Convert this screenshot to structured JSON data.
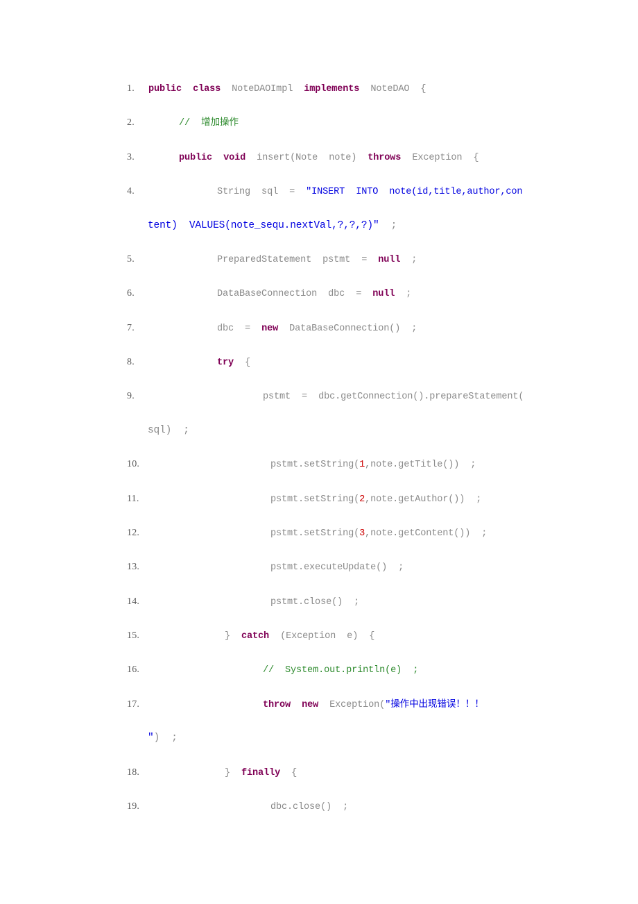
{
  "document": {
    "kind": "code-listing",
    "language": "Java",
    "background_color": "#ffffff",
    "colors": {
      "keyword": "#7F0055",
      "comment": "#2E8B2E",
      "string": "#0000E0",
      "number": "#CC0000",
      "identifier": "#8a8a8a",
      "line_number": "#5a5a5a"
    }
  },
  "lines": [
    {
      "number": "1.",
      "indent": 1,
      "tokens": [
        {
          "t": "public",
          "c": "kw"
        },
        {
          "t": "  ",
          "c": "pn"
        },
        {
          "t": "class",
          "c": "kw"
        },
        {
          "t": "  ",
          "c": "pn"
        },
        {
          "t": "NoteDAOImpl",
          "c": "id"
        },
        {
          "t": "  ",
          "c": "pn"
        },
        {
          "t": "implements",
          "c": "kw"
        },
        {
          "t": "  ",
          "c": "pn"
        },
        {
          "t": "NoteDAO",
          "c": "id"
        },
        {
          "t": "  {",
          "c": "pn"
        }
      ]
    },
    {
      "number": "2.",
      "indent": 5,
      "tokens": [
        {
          "t": "//  增加操作",
          "c": "cmt"
        }
      ]
    },
    {
      "number": "3.",
      "indent": 5,
      "tokens": [
        {
          "t": "public",
          "c": "kw"
        },
        {
          "t": "  ",
          "c": "pn"
        },
        {
          "t": "void",
          "c": "kw"
        },
        {
          "t": "  ",
          "c": "pn"
        },
        {
          "t": "insert(Note  note)",
          "c": "id"
        },
        {
          "t": "  ",
          "c": "pn"
        },
        {
          "t": "throws",
          "c": "kw"
        },
        {
          "t": "  ",
          "c": "pn"
        },
        {
          "t": "Exception",
          "c": "id"
        },
        {
          "t": "  {",
          "c": "pn"
        }
      ]
    },
    {
      "number": "4.",
      "indent": 10,
      "tokens": [
        {
          "t": "String  sql  =  ",
          "c": "id"
        },
        {
          "t": "\"INSERT  INTO  note(id,title,author,con",
          "c": "str"
        }
      ],
      "wrap": [
        {
          "t": "tent)  VALUES(note_sequ.nextVal,?,?,?)\"",
          "c": "str"
        },
        {
          "t": "  ;",
          "c": "pn"
        }
      ]
    },
    {
      "number": "5.",
      "indent": 10,
      "tokens": [
        {
          "t": "PreparedStatement  pstmt  =  ",
          "c": "id"
        },
        {
          "t": "null",
          "c": "kw"
        },
        {
          "t": "  ;",
          "c": "pn"
        }
      ]
    },
    {
      "number": "6.",
      "indent": 10,
      "tokens": [
        {
          "t": "DataBaseConnection  dbc  =  ",
          "c": "id"
        },
        {
          "t": "null",
          "c": "kw"
        },
        {
          "t": "  ;",
          "c": "pn"
        }
      ]
    },
    {
      "number": "7.",
      "indent": 10,
      "tokens": [
        {
          "t": "dbc  =  ",
          "c": "id"
        },
        {
          "t": "new",
          "c": "kw"
        },
        {
          "t": "  ",
          "c": "pn"
        },
        {
          "t": "DataBaseConnection()",
          "c": "id"
        },
        {
          "t": "  ;",
          "c": "pn"
        }
      ]
    },
    {
      "number": "8.",
      "indent": 10,
      "tokens": [
        {
          "t": "try",
          "c": "kw"
        },
        {
          "t": "  {",
          "c": "pn"
        }
      ]
    },
    {
      "number": "9.",
      "indent": 16,
      "tokens": [
        {
          "t": "pstmt  =  dbc.getConnection().prepareStatement(",
          "c": "id"
        }
      ],
      "wrap": [
        {
          "t": "sql)  ;",
          "c": "id"
        }
      ]
    },
    {
      "number": "10.",
      "indent": 17,
      "tokens": [
        {
          "t": "pstmt.setString(",
          "c": "id"
        },
        {
          "t": "1",
          "c": "num"
        },
        {
          "t": ",note.getTitle())",
          "c": "id"
        },
        {
          "t": "  ;",
          "c": "pn"
        }
      ]
    },
    {
      "number": "11.",
      "indent": 17,
      "tokens": [
        {
          "t": "pstmt.setString(",
          "c": "id"
        },
        {
          "t": "2",
          "c": "num"
        },
        {
          "t": ",note.getAuthor())",
          "c": "id"
        },
        {
          "t": "  ;",
          "c": "pn"
        }
      ]
    },
    {
      "number": "12.",
      "indent": 17,
      "tokens": [
        {
          "t": "pstmt.setString(",
          "c": "id"
        },
        {
          "t": "3",
          "c": "num"
        },
        {
          "t": ",note.getContent())",
          "c": "id"
        },
        {
          "t": "  ;",
          "c": "pn"
        }
      ]
    },
    {
      "number": "13.",
      "indent": 17,
      "tokens": [
        {
          "t": "pstmt.executeUpdate()",
          "c": "id"
        },
        {
          "t": "  ;",
          "c": "pn"
        }
      ]
    },
    {
      "number": "14.",
      "indent": 17,
      "tokens": [
        {
          "t": "pstmt.close()",
          "c": "id"
        },
        {
          "t": "  ;",
          "c": "pn"
        }
      ]
    },
    {
      "number": "15.",
      "indent": 11,
      "tokens": [
        {
          "t": "}",
          "c": "pn"
        },
        {
          "t": "  ",
          "c": "pn"
        },
        {
          "t": "catch",
          "c": "kw"
        },
        {
          "t": "  ",
          "c": "pn"
        },
        {
          "t": "(Exception  e)  {",
          "c": "id"
        }
      ]
    },
    {
      "number": "16.",
      "indent": 16,
      "tokens": [
        {
          "t": "//  System.out.println(e)  ;",
          "c": "cmt"
        }
      ]
    },
    {
      "number": "17.",
      "indent": 16,
      "tokens": [
        {
          "t": "throw",
          "c": "kw"
        },
        {
          "t": "  ",
          "c": "pn"
        },
        {
          "t": "new",
          "c": "kw"
        },
        {
          "t": "  ",
          "c": "pn"
        },
        {
          "t": "Exception(",
          "c": "id"
        },
        {
          "t": "\"操作中出现错误！！！",
          "c": "str"
        }
      ],
      "wrap": [
        {
          "t": "\"",
          "c": "str"
        },
        {
          "t": ")  ;",
          "c": "pn"
        }
      ]
    },
    {
      "number": "18.",
      "indent": 11,
      "tokens": [
        {
          "t": "}",
          "c": "pn"
        },
        {
          "t": "  ",
          "c": "pn"
        },
        {
          "t": "finally",
          "c": "kw"
        },
        {
          "t": "  {",
          "c": "pn"
        }
      ]
    },
    {
      "number": "19.",
      "indent": 17,
      "tokens": [
        {
          "t": "dbc.close()",
          "c": "id"
        },
        {
          "t": "  ;",
          "c": "pn"
        }
      ]
    }
  ]
}
